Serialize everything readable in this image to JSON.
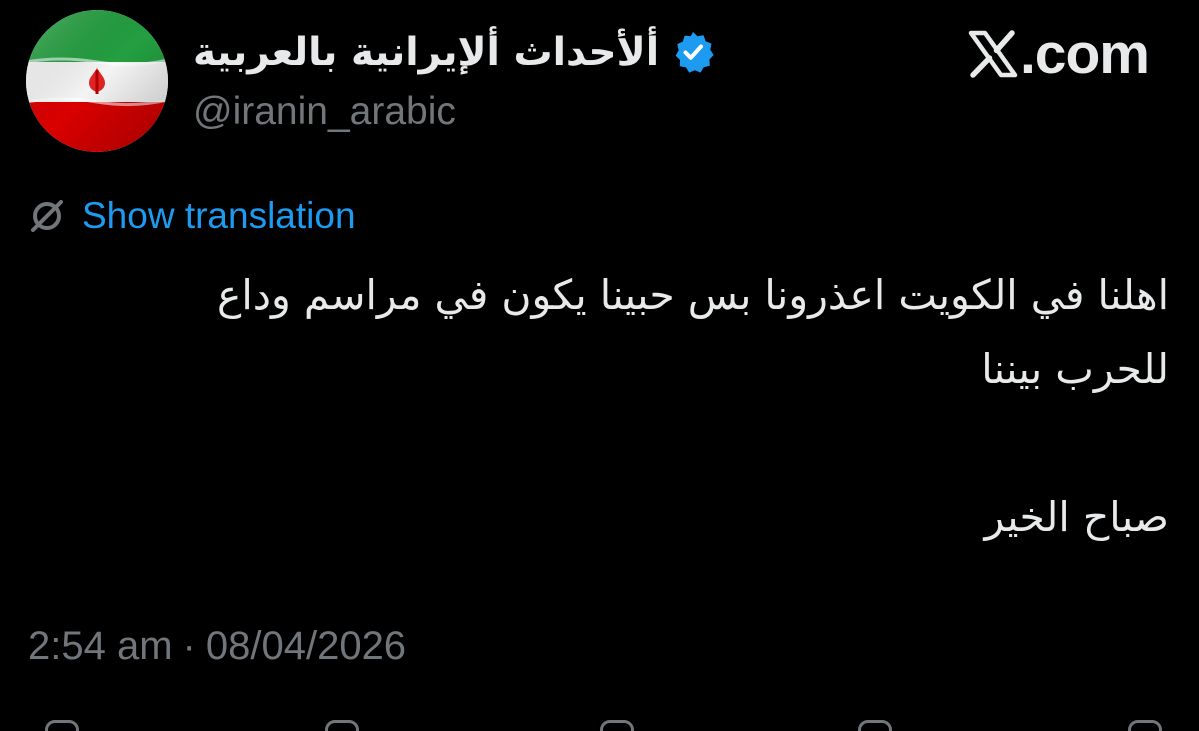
{
  "header": {
    "display_name": "ألأحداث ألإيرانية بالعربية",
    "handle": "@iranin_arabic",
    "site_label": ".com",
    "verified_color": "#1d9bf0",
    "avatar_icon": "iran-flag-avatar"
  },
  "translation": {
    "label": "Show translation",
    "icon": "globe-slash-icon"
  },
  "tweet": {
    "lines": [
      "اهلنا في الكويت اعذرونا بس حبينا يكون في مراسم وداع",
      "للحرب بيننا",
      "",
      "صباح الخير"
    ]
  },
  "meta": {
    "time": "2:54 am",
    "separator": "·",
    "date": "08/04/2026"
  },
  "actions": [
    {
      "icon": "reply-icon"
    },
    {
      "icon": "repost-icon"
    },
    {
      "icon": "like-icon"
    },
    {
      "icon": "bookmark-icon"
    },
    {
      "icon": "share-icon"
    }
  ],
  "colors": {
    "background": "#000000",
    "text": "#e7e9ea",
    "secondary": "#71767b",
    "link": "#1d9bf0"
  }
}
